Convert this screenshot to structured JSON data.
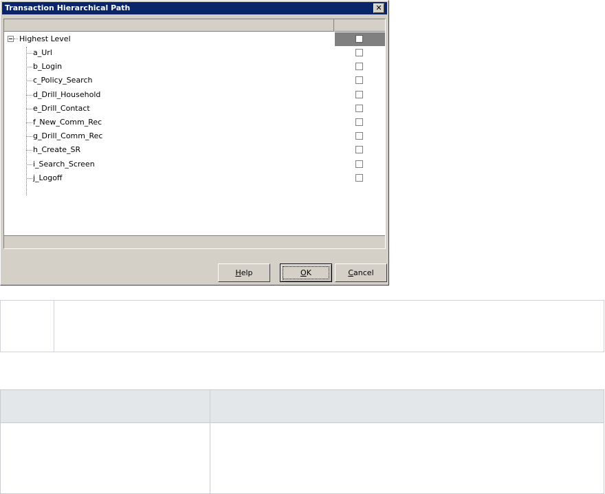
{
  "dialog": {
    "title": "Transaction Hierarchical Path",
    "close_glyph": "✕",
    "root": {
      "label": "Highest Level",
      "checked": false
    },
    "items": [
      {
        "label": "a_Url",
        "checked": false
      },
      {
        "label": "b_Login",
        "checked": false
      },
      {
        "label": "c_Policy_Search",
        "checked": false
      },
      {
        "label": "d_Drill_Household",
        "checked": false
      },
      {
        "label": "e_Drill_Contact",
        "checked": false
      },
      {
        "label": "f_New_Comm_Rec",
        "checked": false
      },
      {
        "label": "g_Drill_Comm_Rec",
        "checked": false
      },
      {
        "label": "h_Create_SR",
        "checked": false
      },
      {
        "label": "i_Search_Screen",
        "checked": false
      },
      {
        "label": "j_Logoff",
        "checked": false
      }
    ],
    "buttons": {
      "help": {
        "mnemonic": "H",
        "rest": "elp"
      },
      "ok": {
        "mnemonic": "O",
        "rest": "K"
      },
      "cancel": {
        "mnemonic": "C",
        "rest": "ancel"
      }
    }
  },
  "colors": {
    "titlebar": "#0a246a",
    "dialog_face": "#d4d0c8",
    "table_header": "#e4e7e9"
  }
}
